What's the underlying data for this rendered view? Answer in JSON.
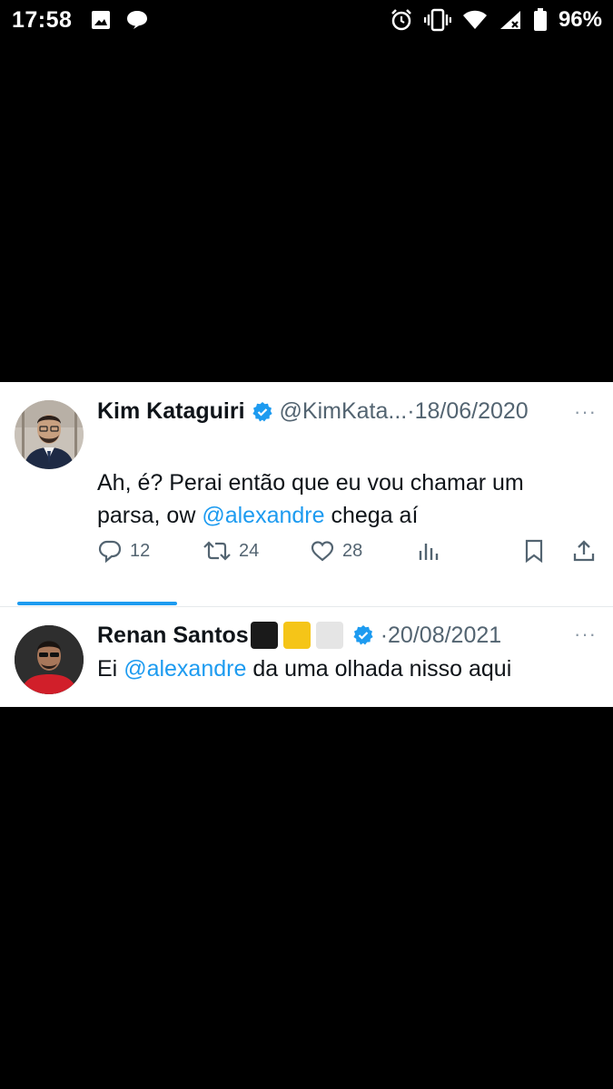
{
  "status_bar": {
    "time": "17:58",
    "battery": "96%",
    "icons_left": [
      "image-icon",
      "chat-bubble-icon"
    ],
    "icons_right": [
      "alarm-icon",
      "vibrate-icon",
      "wifi-icon",
      "signal-icon",
      "battery-icon"
    ]
  },
  "tweets": [
    {
      "author": "Kim Kataguiri",
      "handle": "@KimKata...",
      "separator": "·",
      "date": "18/06/2020",
      "more": "···",
      "text_part1": "Ah, é? Perai então que eu vou chamar um parsa, ow ",
      "mention": "@alexandre",
      "text_part2": " chega aí",
      "replies": "12",
      "retweets": "24",
      "likes": "28"
    },
    {
      "author": "Renan Santos",
      "separator": "·",
      "date": "20/08/2021",
      "more": "···",
      "name_emojis": [
        "#1a1a1a",
        "#f5c518",
        "#e5e5e5"
      ],
      "text_part1": "Ei ",
      "mention": "@alexandre",
      "text_part2": " da uma olhada nisso aqui"
    }
  ],
  "colors": {
    "accent": "#1d9bf0",
    "text": "#0f1419",
    "muted": "#536471"
  }
}
